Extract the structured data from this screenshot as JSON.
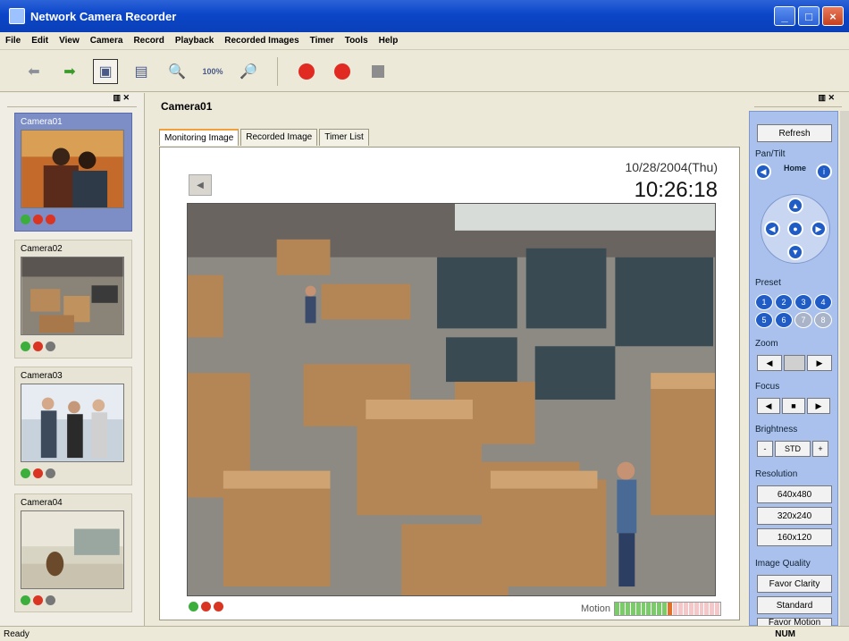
{
  "window": {
    "title": "Network Camera Recorder"
  },
  "menu": [
    "File",
    "Edit",
    "View",
    "Camera",
    "Record",
    "Playback",
    "Recorded Images",
    "Timer",
    "Tools",
    "Help"
  ],
  "toolbar": {
    "zoom_level": "100%"
  },
  "cameras": [
    {
      "name": "Camera01",
      "status": [
        "green",
        "red",
        "rec"
      ]
    },
    {
      "name": "Camera02",
      "status": [
        "green",
        "red",
        "gray"
      ]
    },
    {
      "name": "Camera03",
      "status": [
        "green",
        "red",
        "gray"
      ]
    },
    {
      "name": "Camera04",
      "status": [
        "green",
        "red",
        "gray"
      ]
    }
  ],
  "main": {
    "title": "Camera01",
    "tabs": [
      "Monitoring Image",
      "Recorded Image",
      "Timer List"
    ],
    "date": "10/28/2004(Thu)",
    "time": "10:26:18",
    "motion_label": "Motion",
    "motion_level": 0.55
  },
  "controls": {
    "refresh": "Refresh",
    "pan_tilt": "Pan/Tilt",
    "home": "Home",
    "preset": "Preset",
    "presets": [
      "1",
      "2",
      "3",
      "4",
      "5",
      "6",
      "7",
      "8"
    ],
    "zoom": "Zoom",
    "focus": "Focus",
    "brightness": "Brightness",
    "brightness_value": "STD",
    "resolution": "Resolution",
    "resolutions": [
      "640x480",
      "320x240",
      "160x120"
    ],
    "image_quality": "Image Quality",
    "qualities": [
      "Favor Clarity",
      "Standard",
      "Favor Motion"
    ]
  },
  "status": {
    "text": "Ready",
    "num": "NUM"
  }
}
